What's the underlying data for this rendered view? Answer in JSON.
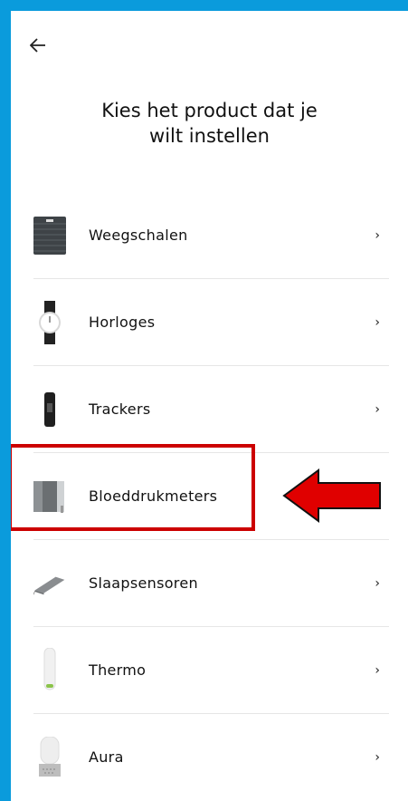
{
  "header": {
    "back_icon": "arrow-left-icon"
  },
  "title": "Kies het product   dat je\nwilt instellen",
  "items": [
    {
      "label": "Weegschalen",
      "icon": "scale-icon"
    },
    {
      "label": "Horloges",
      "icon": "watch-icon"
    },
    {
      "label": "Trackers",
      "icon": "tracker-icon"
    },
    {
      "label": "Bloeddrukmeters",
      "icon": "blood-pressure-monitor-icon"
    },
    {
      "label": "Slaapsensoren",
      "icon": "sleep-sensor-icon"
    },
    {
      "label": "Thermo",
      "icon": "thermometer-icon"
    },
    {
      "label": "Aura",
      "icon": "aura-icon"
    }
  ],
  "chevron": "›",
  "colors": {
    "frame": "#0a9bdc",
    "annotation": "#cc0000"
  }
}
